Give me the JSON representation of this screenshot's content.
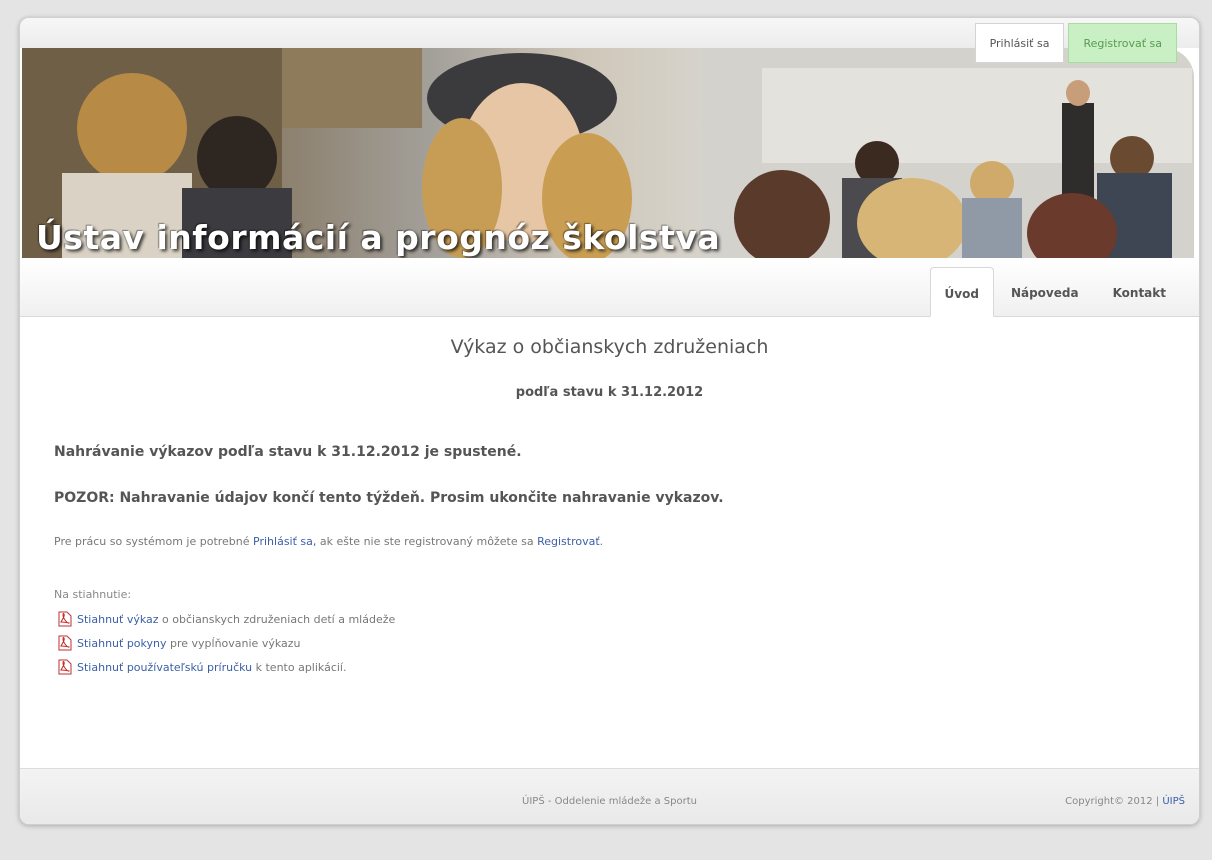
{
  "auth": {
    "login_label": "Prihlásiť sa",
    "register_label": "Registrovať sa"
  },
  "banner": {
    "title": "Ústav informácií a prognóz školstva"
  },
  "nav": {
    "tabs": [
      {
        "label": "Úvod",
        "active": true
      },
      {
        "label": "Nápoveda",
        "active": false
      },
      {
        "label": "Kontakt",
        "active": false
      }
    ]
  },
  "main": {
    "title": "Výkaz o občianskych združeniach",
    "subtitle": "podľa stavu k 31.12.2012",
    "notice_1": "Nahrávanie výkazov podľa stavu k 31.12.2012 je spustené.",
    "notice_2": "POZOR: Nahravanie údajov končí tento týždeň. Prosim ukončite nahravanie vykazov.",
    "info": {
      "prefix": "Pre prácu so systémom je potrebné ",
      "login_link": "Prihlásiť sa,",
      "middle": " ak ešte nie ste registrovaný môžete sa ",
      "register_link": "Registrovať",
      "suffix": "."
    },
    "downloads_title": "Na stiahnutie:",
    "downloads": [
      {
        "link": "Stiahnuť výkaz",
        "text": " o občianskych združeniach detí a mládeže",
        "icon": "pdf-icon"
      },
      {
        "link": "Stiahnuť pokyny",
        "text": " pre vypĺňovanie výkazu",
        "icon": "pdf-icon"
      },
      {
        "link": "Stiahnuť používateľskú príručku",
        "text": " k tento aplikácií.",
        "icon": "pdf-icon"
      }
    ]
  },
  "footer": {
    "center": "ÚIPŠ - Oddelenie mládeže a Sportu",
    "copyright": "Copyright© 2012 | ",
    "copyright_link": "ÚIPŠ"
  },
  "colors": {
    "link": "#3a5fa8",
    "register_bg": "#c9f0c4",
    "text": "#555555"
  }
}
